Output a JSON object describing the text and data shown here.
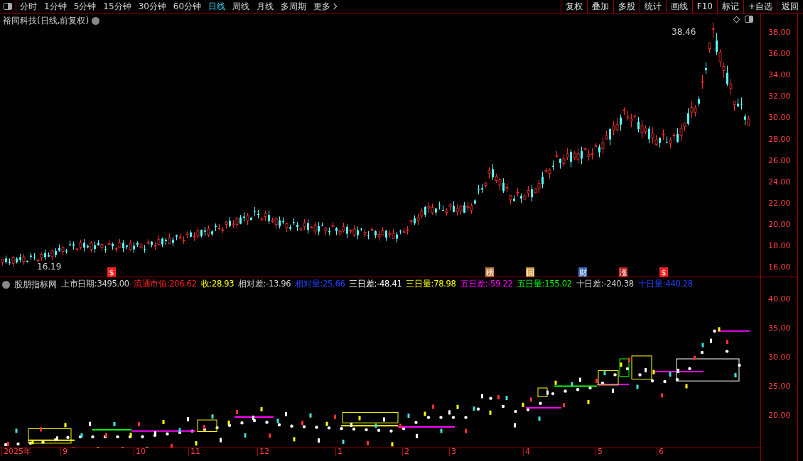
{
  "toolbar": {
    "periods": [
      {
        "label": "分时",
        "selected": false
      },
      {
        "label": "1分钟",
        "selected": false
      },
      {
        "label": "5分钟",
        "selected": false
      },
      {
        "label": "15分钟",
        "selected": false
      },
      {
        "label": "30分钟",
        "selected": false
      },
      {
        "label": "60分钟",
        "selected": false
      },
      {
        "label": "日线",
        "selected": true
      },
      {
        "label": "周线",
        "selected": false
      },
      {
        "label": "月线",
        "selected": false
      },
      {
        "label": "多周期",
        "selected": false
      },
      {
        "label": "更多",
        "selected": false
      }
    ],
    "actions": [
      "复权",
      "叠加",
      "多股",
      "统计",
      "画线",
      "F10",
      "标记",
      "+自选",
      "返回"
    ]
  },
  "price_chart": {
    "title": "裕同科技(日线,前复权)",
    "high_label": "38.46",
    "low_label": "16.19",
    "y_axis": [
      "38.00",
      "36.00",
      "34.00",
      "32.00",
      "30.00",
      "28.00",
      "26.00",
      "24.00",
      "22.00",
      "20.00",
      "18.00",
      "16.00"
    ],
    "events": [
      {
        "label": "$",
        "color": "#ff2020"
      },
      {
        "label": "榜",
        "color": "#c08040"
      },
      {
        "label": "回",
        "color": "#d0a040"
      },
      {
        "label": "财",
        "color": "#4070c0"
      },
      {
        "label": "涨",
        "color": "#c02020"
      },
      {
        "label": "$",
        "color": "#ff2020"
      }
    ]
  },
  "indicator": {
    "name": "股朋指标网",
    "values": [
      {
        "label": "上市日期:",
        "value": "3495.00",
        "color": "#d0d0d0"
      },
      {
        "label": "流通市值:",
        "value": "206.62",
        "color": "#ff2020"
      },
      {
        "label": "收:",
        "value": "28.93",
        "color": "#ffff00"
      },
      {
        "label": "相对差:",
        "value": "-13.96",
        "color": "#d0d0d0"
      },
      {
        "label": "相对量:",
        "value": "25.66",
        "color": "#2040ff"
      },
      {
        "label": "三日差:",
        "value": "-48.41",
        "color": "#ffffff"
      },
      {
        "label": "三日量:",
        "value": "78.98",
        "color": "#ffff00"
      },
      {
        "label": "五日差:",
        "value": "-59.22",
        "color": "#ff00ff"
      },
      {
        "label": "五日量:",
        "value": "155.02",
        "color": "#00ff00"
      },
      {
        "label": "十日差:",
        "value": "-240.38",
        "color": "#d0d0d0"
      },
      {
        "label": "十日量:",
        "value": "440.28",
        "color": "#2040ff"
      }
    ],
    "y_axis": [
      "40.00",
      "35.00",
      "30.00",
      "25.00",
      "20.00"
    ]
  },
  "date_axis": [
    "2025年",
    "9",
    "10",
    "11",
    "12",
    "1",
    "2",
    "3",
    "4",
    "5",
    "6"
  ]
}
